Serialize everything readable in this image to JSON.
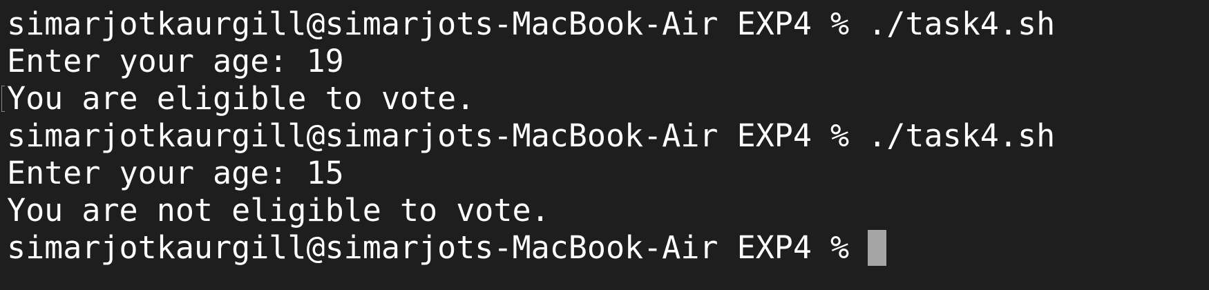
{
  "terminal": {
    "lines": [
      {
        "prompt": "simarjotkaurgill@simarjots-MacBook-Air EXP4 % ",
        "command": "./task4.sh"
      },
      {
        "text": "Enter your age: 19"
      },
      {
        "text": "You are eligible to vote."
      },
      {
        "prompt": "simarjotkaurgill@simarjots-MacBook-Air EXP4 % ",
        "command": "./task4.sh"
      },
      {
        "text": "Enter your age: 15"
      },
      {
        "text": "You are not eligible to vote."
      },
      {
        "prompt": "simarjotkaurgill@simarjots-MacBook-Air EXP4 % ",
        "command": ""
      }
    ],
    "colors": {
      "background": "#1e1e1e",
      "foreground": "#ffffff",
      "cursor": "#a6a6a6"
    }
  }
}
